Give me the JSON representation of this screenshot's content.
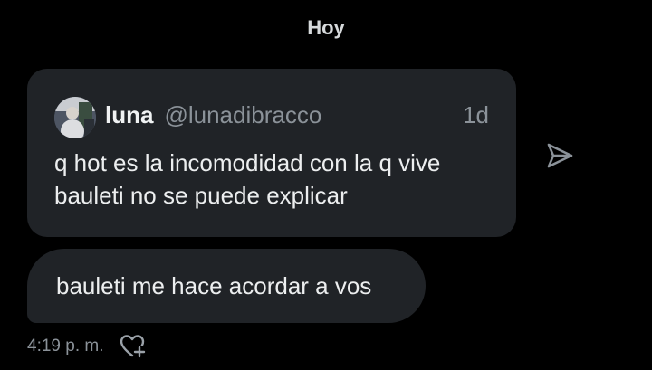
{
  "header": {
    "day_label": "Hoy"
  },
  "quoted_post": {
    "author_name": "luna",
    "author_handle": "@lunadibracco",
    "age": "1d",
    "text": "q hot es la incomodidad con la q vive bauleti no se puede explicar"
  },
  "reply": {
    "text": "bauleti me hace acordar a vos",
    "timestamp": "4:19 p. m."
  },
  "icons": {
    "share": "send-arrow-icon",
    "react": "heart-plus-icon"
  },
  "colors": {
    "background": "#000000",
    "bubble": "#202327",
    "muted": "#8b9299"
  }
}
